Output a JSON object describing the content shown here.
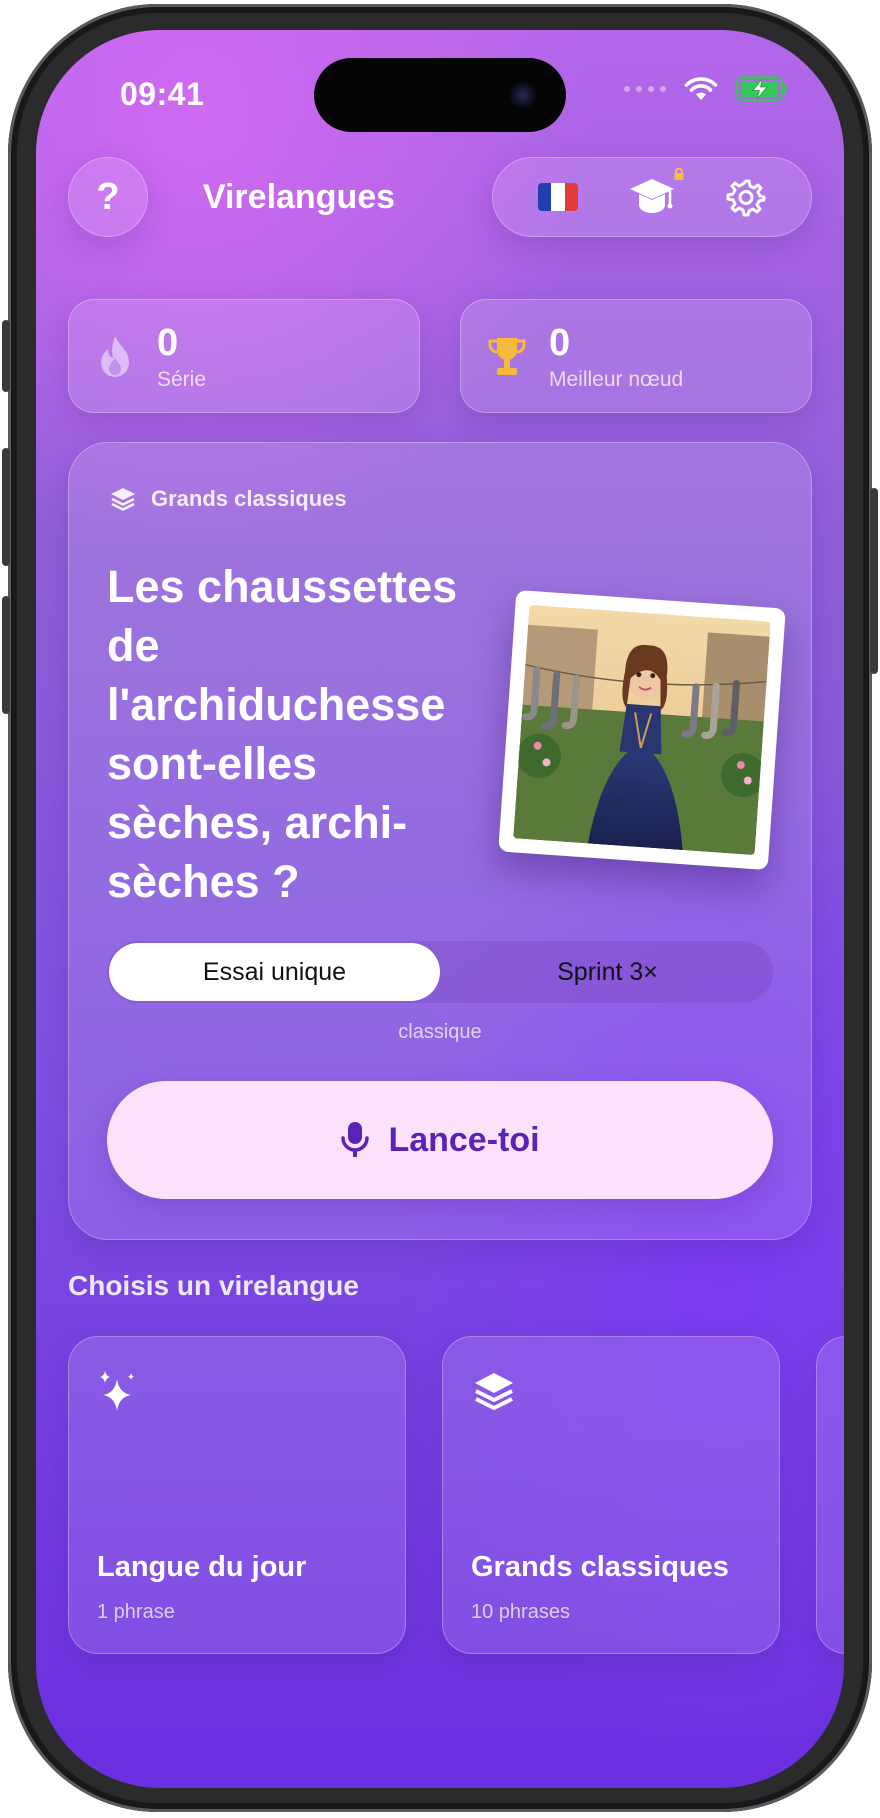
{
  "status_bar": {
    "time": "09:41"
  },
  "header": {
    "help_label": "?",
    "title": "Virelangues",
    "language_flag": "french-flag",
    "icons": [
      "question-icon",
      "graduation-cap-icon",
      "lock-icon",
      "gear-icon"
    ]
  },
  "stats": [
    {
      "value": "0",
      "label": "Série",
      "icon": "flame-icon"
    },
    {
      "value": "0",
      "label": "Meilleur nœud",
      "icon": "trophy-icon"
    }
  ],
  "featured": {
    "category": "Grands classiques",
    "category_icon": "layers-icon",
    "phrase": "Les chaussettes de l'archiduchesse sont-elles sèches, archi-sèches ?",
    "modes": [
      {
        "label": "Essai unique",
        "selected": true
      },
      {
        "label": "Sprint 3×",
        "selected": false
      }
    ],
    "mode_caption": "classique",
    "cta_label": "Lance-toi",
    "cta_icon": "microphone-icon"
  },
  "section_title": "Choisis un virelangue",
  "packs": [
    {
      "title": "Langue du jour",
      "subtitle": "1 phrase",
      "icon": "sparkles-icon"
    },
    {
      "title": "Grands classiques",
      "subtitle": "10 phrases",
      "icon": "layers-icon"
    }
  ],
  "colors": {
    "accent_purple": "#5a22b6",
    "cta_background": "#fde2fb",
    "trophy_gold": "#f6b93b",
    "battery_green": "#34c759"
  }
}
